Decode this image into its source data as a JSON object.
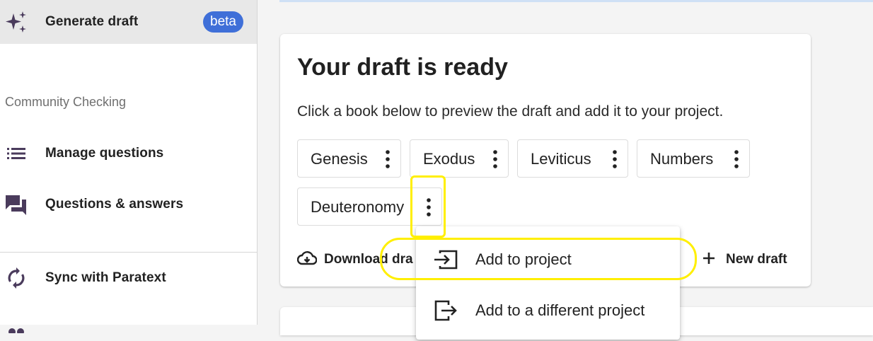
{
  "sidebar": {
    "generate_draft": {
      "label": "Generate draft",
      "badge": "beta",
      "icon": "sparkle-icon"
    },
    "section_community": "Community Checking",
    "manage_questions": {
      "label": "Manage questions",
      "icon": "list-icon"
    },
    "questions_answers": {
      "label": "Questions & answers",
      "icon": "forum-icon"
    },
    "sync": {
      "label": "Sync with Paratext",
      "icon": "sync-icon"
    }
  },
  "card": {
    "title": "Your draft is ready",
    "description": "Click a book below to preview the draft and add it to your project.",
    "books": [
      "Genesis",
      "Exodus",
      "Leviticus",
      "Numbers",
      "Deuteronomy"
    ],
    "download_label": "Download dra",
    "new_draft_label": "New draft"
  },
  "menu": {
    "items": [
      {
        "label": "Add to project",
        "icon": "input-icon"
      },
      {
        "label": "Add to a different project",
        "icon": "exit-icon"
      }
    ]
  },
  "colors": {
    "accent": "#3f6fd8",
    "highlight": "#ffef00",
    "icon_purple": "#4a3b5c"
  }
}
